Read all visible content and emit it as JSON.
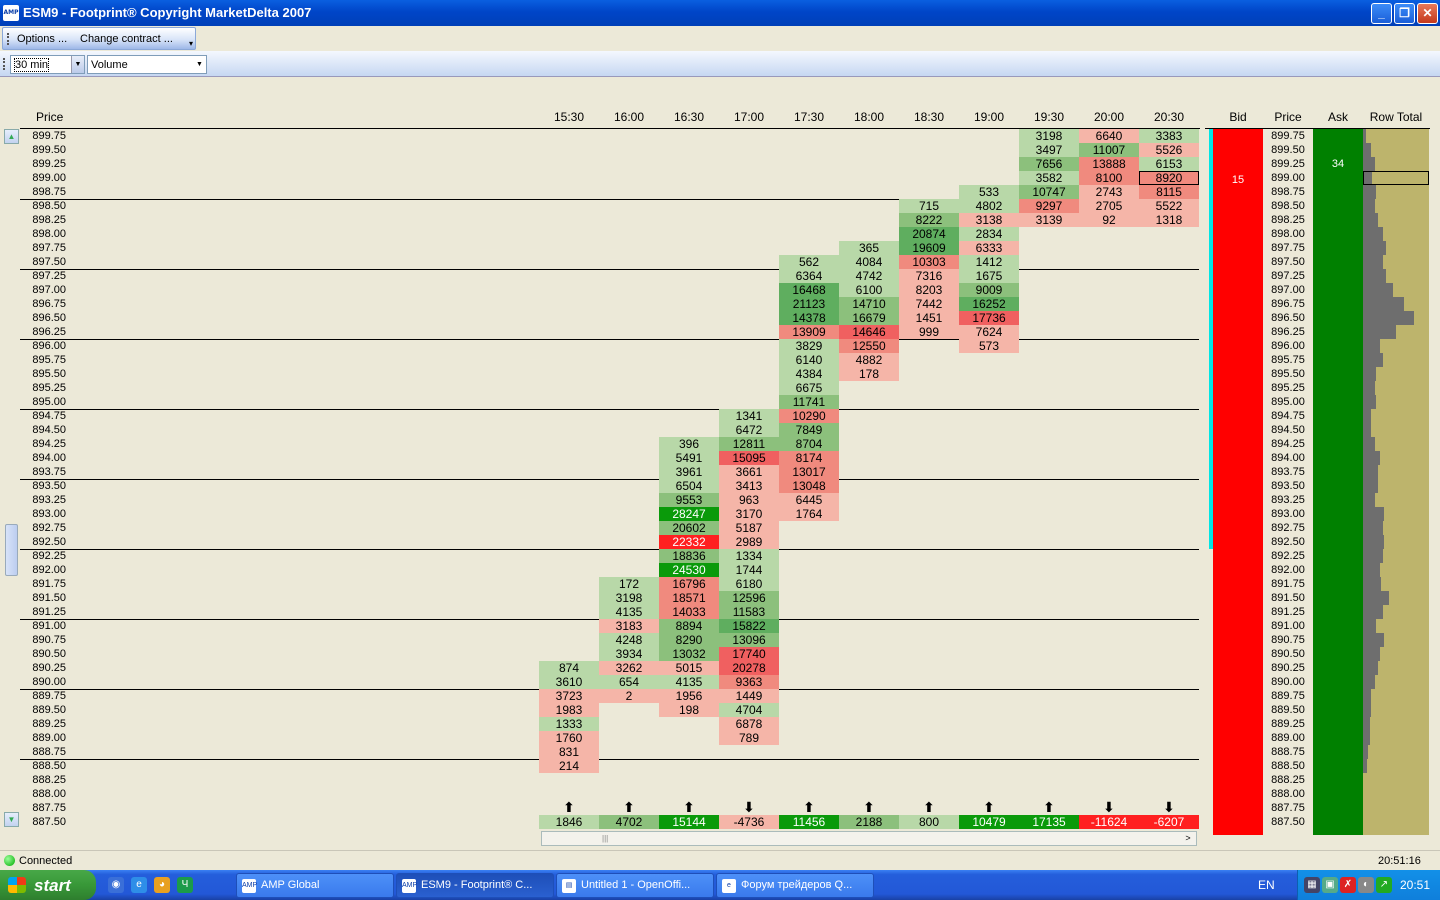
{
  "window": {
    "title": "ESM9 - Footprint® Copyright MarketDelta 2007",
    "app_icon": "amp-icon",
    "min": "_",
    "max": "❐",
    "close": "✕"
  },
  "menu": {
    "options": "Options ...",
    "change_contract": "Change contract ..."
  },
  "toolbar": {
    "timeframe": "30 min",
    "mode": "Volume"
  },
  "headers": {
    "price": "Price",
    "bid": "Bid",
    "ask": "Ask",
    "row_total": "Row Total"
  },
  "times": [
    "15:30",
    "16:00",
    "16:30",
    "17:00",
    "17:30",
    "18:00",
    "18:30",
    "19:00",
    "19:30",
    "20:00",
    "20:30"
  ],
  "prices": [
    "899.75",
    "899.50",
    "899.25",
    "899.00",
    "898.75",
    "898.50",
    "898.25",
    "898.00",
    "897.75",
    "897.50",
    "897.25",
    "897.00",
    "896.75",
    "896.50",
    "896.25",
    "896.00",
    "895.75",
    "895.50",
    "895.25",
    "895.00",
    "894.75",
    "894.50",
    "894.25",
    "894.00",
    "893.75",
    "893.50",
    "893.25",
    "893.00",
    "892.75",
    "892.50",
    "892.25",
    "892.00",
    "891.75",
    "891.50",
    "891.25",
    "891.00",
    "890.75",
    "890.50",
    "890.25",
    "890.00",
    "889.75",
    "889.50",
    "889.25",
    "889.00",
    "888.75",
    "888.50",
    "888.25",
    "888.00",
    "887.75",
    "887.50"
  ],
  "columns": [
    {
      "cells": [
        {
          "p": "890.25",
          "v": "874",
          "c": "g1"
        },
        {
          "p": "890.00",
          "v": "3610",
          "c": "g1"
        },
        {
          "p": "889.75",
          "v": "3723",
          "c": "r1"
        },
        {
          "p": "889.50",
          "v": "1983",
          "c": "r1"
        },
        {
          "p": "889.25",
          "v": "1333",
          "c": "g1"
        },
        {
          "p": "889.00",
          "v": "1760",
          "c": "r1"
        },
        {
          "p": "888.75",
          "v": "831",
          "c": "r1"
        },
        {
          "p": "888.50",
          "v": "214",
          "c": "r1"
        }
      ]
    },
    {
      "cells": [
        {
          "p": "891.75",
          "v": "172",
          "c": "g1"
        },
        {
          "p": "891.50",
          "v": "3198",
          "c": "g1"
        },
        {
          "p": "891.25",
          "v": "4135",
          "c": "g1"
        },
        {
          "p": "891.00",
          "v": "3183",
          "c": "r1"
        },
        {
          "p": "890.75",
          "v": "4248",
          "c": "g1"
        },
        {
          "p": "890.50",
          "v": "3934",
          "c": "g1"
        },
        {
          "p": "890.25",
          "v": "3262",
          "c": "r1"
        },
        {
          "p": "890.00",
          "v": "654",
          "c": "g1"
        },
        {
          "p": "889.75",
          "v": "2",
          "c": "r1"
        }
      ]
    },
    {
      "cells": [
        {
          "p": "894.25",
          "v": "396",
          "c": "g1"
        },
        {
          "p": "894.00",
          "v": "5491",
          "c": "g1"
        },
        {
          "p": "893.75",
          "v": "3961",
          "c": "g1"
        },
        {
          "p": "893.50",
          "v": "6504",
          "c": "g1"
        },
        {
          "p": "893.25",
          "v": "9553",
          "c": "g2"
        },
        {
          "p": "893.00",
          "v": "28247",
          "c": "g4"
        },
        {
          "p": "892.75",
          "v": "20602",
          "c": "g2"
        },
        {
          "p": "892.50",
          "v": "22332",
          "c": "r4"
        },
        {
          "p": "892.25",
          "v": "18836",
          "c": "g2"
        },
        {
          "p": "892.00",
          "v": "24530",
          "c": "g4"
        },
        {
          "p": "891.75",
          "v": "16796",
          "c": "r2"
        },
        {
          "p": "891.50",
          "v": "18571",
          "c": "r2"
        },
        {
          "p": "891.25",
          "v": "14033",
          "c": "r2"
        },
        {
          "p": "891.00",
          "v": "8894",
          "c": "g2"
        },
        {
          "p": "890.75",
          "v": "8290",
          "c": "g2"
        },
        {
          "p": "890.50",
          "v": "13032",
          "c": "g2"
        },
        {
          "p": "890.25",
          "v": "5015",
          "c": "r1"
        },
        {
          "p": "890.00",
          "v": "4135",
          "c": "g1"
        },
        {
          "p": "889.75",
          "v": "1956",
          "c": "r1"
        },
        {
          "p": "889.50",
          "v": "198",
          "c": "r1"
        }
      ]
    },
    {
      "cells": [
        {
          "p": "894.75",
          "v": "1341",
          "c": "g1"
        },
        {
          "p": "894.50",
          "v": "6472",
          "c": "g1"
        },
        {
          "p": "894.25",
          "v": "12811",
          "c": "g2"
        },
        {
          "p": "894.00",
          "v": "15095",
          "c": "r3"
        },
        {
          "p": "893.75",
          "v": "3661",
          "c": "r1"
        },
        {
          "p": "893.50",
          "v": "3413",
          "c": "r1"
        },
        {
          "p": "893.25",
          "v": "963",
          "c": "r1"
        },
        {
          "p": "893.00",
          "v": "3170",
          "c": "r1"
        },
        {
          "p": "892.75",
          "v": "5187",
          "c": "r1"
        },
        {
          "p": "892.50",
          "v": "2989",
          "c": "r1"
        },
        {
          "p": "892.25",
          "v": "1334",
          "c": "g1"
        },
        {
          "p": "892.00",
          "v": "1744",
          "c": "g1"
        },
        {
          "p": "891.75",
          "v": "6180",
          "c": "g1"
        },
        {
          "p": "891.50",
          "v": "12596",
          "c": "g2"
        },
        {
          "p": "891.25",
          "v": "11583",
          "c": "g2"
        },
        {
          "p": "891.00",
          "v": "15822",
          "c": "g3"
        },
        {
          "p": "890.75",
          "v": "13096",
          "c": "g2"
        },
        {
          "p": "890.50",
          "v": "17740",
          "c": "r3"
        },
        {
          "p": "890.25",
          "v": "20278",
          "c": "r3"
        },
        {
          "p": "890.00",
          "v": "9363",
          "c": "r2"
        },
        {
          "p": "889.75",
          "v": "1449",
          "c": "r1"
        },
        {
          "p": "889.50",
          "v": "4704",
          "c": "g1"
        },
        {
          "p": "889.25",
          "v": "6878",
          "c": "r1"
        },
        {
          "p": "889.00",
          "v": "789",
          "c": "r1"
        }
      ]
    },
    {
      "cells": [
        {
          "p": "897.50",
          "v": "562",
          "c": "g1"
        },
        {
          "p": "897.25",
          "v": "6364",
          "c": "g1"
        },
        {
          "p": "897.00",
          "v": "16468",
          "c": "g3"
        },
        {
          "p": "896.75",
          "v": "21123",
          "c": "g3"
        },
        {
          "p": "896.50",
          "v": "14378",
          "c": "g3"
        },
        {
          "p": "896.25",
          "v": "13909",
          "c": "r2"
        },
        {
          "p": "896.00",
          "v": "3829",
          "c": "g1"
        },
        {
          "p": "895.75",
          "v": "6140",
          "c": "g1"
        },
        {
          "p": "895.50",
          "v": "4384",
          "c": "g1"
        },
        {
          "p": "895.25",
          "v": "6675",
          "c": "g1"
        },
        {
          "p": "895.00",
          "v": "11741",
          "c": "g2"
        },
        {
          "p": "894.75",
          "v": "10290",
          "c": "r2"
        },
        {
          "p": "894.50",
          "v": "7849",
          "c": "g2"
        },
        {
          "p": "894.25",
          "v": "8704",
          "c": "g2"
        },
        {
          "p": "894.00",
          "v": "8174",
          "c": "r2"
        },
        {
          "p": "893.75",
          "v": "13017",
          "c": "r2"
        },
        {
          "p": "893.50",
          "v": "13048",
          "c": "r2"
        },
        {
          "p": "893.25",
          "v": "6445",
          "c": "r1"
        },
        {
          "p": "893.00",
          "v": "1764",
          "c": "r1"
        }
      ]
    },
    {
      "cells": [
        {
          "p": "897.75",
          "v": "365",
          "c": "g1"
        },
        {
          "p": "897.50",
          "v": "4084",
          "c": "g1"
        },
        {
          "p": "897.25",
          "v": "4742",
          "c": "g1"
        },
        {
          "p": "897.00",
          "v": "6100",
          "c": "g1"
        },
        {
          "p": "896.75",
          "v": "14710",
          "c": "g2"
        },
        {
          "p": "896.50",
          "v": "16679",
          "c": "g2"
        },
        {
          "p": "896.25",
          "v": "14646",
          "c": "r3"
        },
        {
          "p": "896.00",
          "v": "12550",
          "c": "r2"
        },
        {
          "p": "895.75",
          "v": "4882",
          "c": "r1"
        },
        {
          "p": "895.50",
          "v": "178",
          "c": "r1"
        }
      ]
    },
    {
      "cells": [
        {
          "p": "898.50",
          "v": "715",
          "c": "g1"
        },
        {
          "p": "898.25",
          "v": "8222",
          "c": "g2"
        },
        {
          "p": "898.00",
          "v": "20874",
          "c": "g3"
        },
        {
          "p": "897.75",
          "v": "19609",
          "c": "g3"
        },
        {
          "p": "897.50",
          "v": "10303",
          "c": "r2"
        },
        {
          "p": "897.25",
          "v": "7316",
          "c": "r1"
        },
        {
          "p": "897.00",
          "v": "8203",
          "c": "r1"
        },
        {
          "p": "896.75",
          "v": "7442",
          "c": "r1"
        },
        {
          "p": "896.50",
          "v": "1451",
          "c": "r1"
        },
        {
          "p": "896.25",
          "v": "999",
          "c": "r1"
        }
      ]
    },
    {
      "cells": [
        {
          "p": "898.75",
          "v": "533",
          "c": "g1"
        },
        {
          "p": "898.50",
          "v": "4802",
          "c": "g1"
        },
        {
          "p": "898.25",
          "v": "3138",
          "c": "r1"
        },
        {
          "p": "898.00",
          "v": "2834",
          "c": "g1"
        },
        {
          "p": "897.75",
          "v": "6333",
          "c": "r1"
        },
        {
          "p": "897.50",
          "v": "1412",
          "c": "g1"
        },
        {
          "p": "897.25",
          "v": "1675",
          "c": "g1"
        },
        {
          "p": "897.00",
          "v": "9009",
          "c": "g2"
        },
        {
          "p": "896.75",
          "v": "16252",
          "c": "g3"
        },
        {
          "p": "896.50",
          "v": "17736",
          "c": "r3"
        },
        {
          "p": "896.25",
          "v": "7624",
          "c": "r1"
        },
        {
          "p": "896.00",
          "v": "573",
          "c": "r1"
        }
      ]
    },
    {
      "cells": [
        {
          "p": "899.75",
          "v": "3198",
          "c": "g1"
        },
        {
          "p": "899.50",
          "v": "3497",
          "c": "g1"
        },
        {
          "p": "899.25",
          "v": "7656",
          "c": "g2"
        },
        {
          "p": "899.00",
          "v": "3582",
          "c": "g1"
        },
        {
          "p": "898.75",
          "v": "10747",
          "c": "g2"
        },
        {
          "p": "898.50",
          "v": "9297",
          "c": "r2"
        },
        {
          "p": "898.25",
          "v": "3139",
          "c": "r1"
        }
      ]
    },
    {
      "cells": [
        {
          "p": "899.75",
          "v": "6640",
          "c": "r1"
        },
        {
          "p": "899.50",
          "v": "11007",
          "c": "g2"
        },
        {
          "p": "899.25",
          "v": "13888",
          "c": "r2"
        },
        {
          "p": "899.00",
          "v": "8100",
          "c": "r2"
        },
        {
          "p": "898.75",
          "v": "2743",
          "c": "r1"
        },
        {
          "p": "898.50",
          "v": "2705",
          "c": "r1"
        },
        {
          "p": "898.25",
          "v": "92",
          "c": "r1"
        }
      ]
    },
    {
      "cells": [
        {
          "p": "899.75",
          "v": "3383",
          "c": "g1"
        },
        {
          "p": "899.50",
          "v": "5526",
          "c": "r1"
        },
        {
          "p": "899.25",
          "v": "6153",
          "c": "g1"
        },
        {
          "p": "899.00",
          "v": "8920",
          "c": "r2"
        },
        {
          "p": "898.75",
          "v": "8115",
          "c": "r2"
        },
        {
          "p": "898.50",
          "v": "5522",
          "c": "r1"
        },
        {
          "p": "898.25",
          "v": "1318",
          "c": "r1"
        }
      ]
    }
  ],
  "deltas": [
    {
      "v": "1846",
      "c": "g1",
      "a": "🡅"
    },
    {
      "v": "4702",
      "c": "g2",
      "a": "🡅"
    },
    {
      "v": "15144",
      "c": "g4",
      "a": "🡅"
    },
    {
      "v": "-4736",
      "c": "r1",
      "a": "🡇"
    },
    {
      "v": "11456",
      "c": "g4",
      "a": "🡅"
    },
    {
      "v": "2188",
      "c": "g2",
      "a": "🡅"
    },
    {
      "v": "800",
      "c": "g1",
      "a": "🡅"
    },
    {
      "v": "10479",
      "c": "g4",
      "a": "🡅"
    },
    {
      "v": "17135",
      "c": "g4",
      "a": "🡅"
    },
    {
      "v": "-11624",
      "c": "r4",
      "a": "🡇"
    },
    {
      "v": "-6207",
      "c": "r4",
      "a": "🡇"
    }
  ],
  "ladder": {
    "bid_value": "15",
    "bid_price": "899.00",
    "ask_value": "34",
    "ask_price": "899.25",
    "current_price": "899.00"
  },
  "row_totals": [
    0.05,
    0.12,
    0.18,
    0.14,
    0.2,
    0.18,
    0.22,
    0.3,
    0.35,
    0.3,
    0.35,
    0.45,
    0.62,
    0.78,
    0.5,
    0.25,
    0.3,
    0.2,
    0.18,
    0.2,
    0.12,
    0.12,
    0.18,
    0.25,
    0.22,
    0.22,
    0.18,
    0.32,
    0.3,
    0.32,
    0.3,
    0.25,
    0.28,
    0.4,
    0.3,
    0.2,
    0.32,
    0.25,
    0.22,
    0.18,
    0.12,
    0.12,
    0.1,
    0.1,
    0.08,
    0.06,
    0.0,
    0.0,
    0.0,
    0.0
  ],
  "colors": {
    "g1": "#B8D8A8",
    "g2": "#8CC07C",
    "g3": "#5FAE5F",
    "g4": "#0A9A0A",
    "r1": "#F5B5A8",
    "r2": "#F08A7E",
    "r3": "#F06060",
    "r4": "#FF2020"
  },
  "status": {
    "connection": "Connected",
    "time": "20:51:16"
  },
  "taskbar": {
    "start": "start",
    "tasks": [
      "AMP Global",
      "ESM9 - Footprint® C...",
      "Untitled 1 - OpenOffi...",
      "Форум трейдеров Q..."
    ],
    "lang": "EN",
    "clock": "20:51"
  }
}
